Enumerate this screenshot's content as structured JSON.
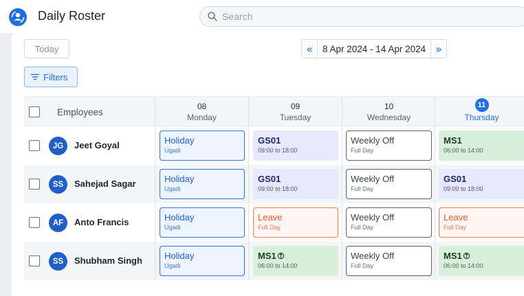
{
  "app": {
    "title": "Daily Roster",
    "logo_icon": "people-circle-icon",
    "accent_color": "#1f6fe0"
  },
  "search": {
    "placeholder": "Search",
    "value": ""
  },
  "toolbar": {
    "today_label": "Today",
    "prev_label": "«",
    "next_label": "»",
    "date_range": "8 Apr 2024 - 14 Apr 2024",
    "filters_label": "Filters"
  },
  "grid": {
    "employees_header": "Employees",
    "days": [
      {
        "num": "08",
        "name": "Monday",
        "today": false
      },
      {
        "num": "09",
        "name": "Tuesday",
        "today": false
      },
      {
        "num": "10",
        "name": "Wednesday",
        "today": false
      },
      {
        "num": "11",
        "name": "Thursday",
        "today": true
      }
    ],
    "rows": [
      {
        "initials": "JG",
        "name": "Jeet Goyal",
        "shifts": [
          {
            "kind": "holiday",
            "title": "Holiday",
            "sub": "Ugadi"
          },
          {
            "kind": "gs",
            "title": "GS01",
            "sub": "09:00 to 18:00"
          },
          {
            "kind": "off",
            "title": "Weekly Off",
            "sub": "Full Day"
          },
          {
            "kind": "ms",
            "title": "MS1",
            "sub": "06:00 to 14:00"
          }
        ]
      },
      {
        "initials": "SS",
        "name": "Sahejad Sagar",
        "shifts": [
          {
            "kind": "holiday",
            "title": "Holiday",
            "sub": "Ugadi"
          },
          {
            "kind": "gs",
            "title": "GS01",
            "sub": "09:00 to 18:00"
          },
          {
            "kind": "off",
            "title": "Weekly Off",
            "sub": "Full Day"
          },
          {
            "kind": "gs",
            "title": "GS01",
            "sub": "09:00 to 18:00"
          }
        ]
      },
      {
        "initials": "AF",
        "name": "Anto Francis",
        "shifts": [
          {
            "kind": "holiday",
            "title": "Holiday",
            "sub": "Ugadi"
          },
          {
            "kind": "leave",
            "title": "Leave",
            "sub": "Full Day"
          },
          {
            "kind": "off",
            "title": "Weekly Off",
            "sub": "Full Day"
          },
          {
            "kind": "leave",
            "title": "Leave",
            "sub": "Full Day"
          }
        ]
      },
      {
        "initials": "SS",
        "name": "Shubham Singh",
        "shifts": [
          {
            "kind": "holiday",
            "title": "Holiday",
            "sub": "Ugadi"
          },
          {
            "kind": "ms",
            "title": "MS1",
            "sub": "06:00 to 14:00",
            "icon": "cycle-icon"
          },
          {
            "kind": "off",
            "title": "Weekly Off",
            "sub": "Full Day"
          },
          {
            "kind": "ms",
            "title": "MS1",
            "sub": "06:00 to 14:00",
            "icon": "cycle-icon"
          }
        ]
      }
    ]
  }
}
